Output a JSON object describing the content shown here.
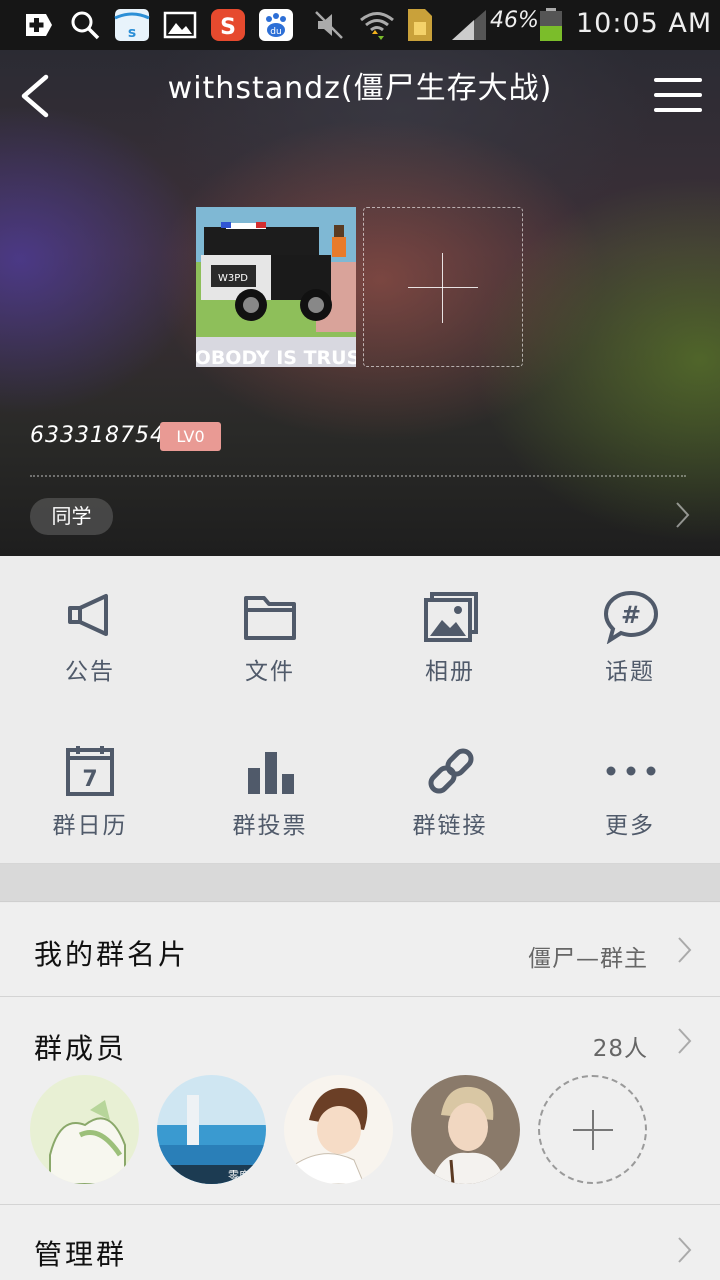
{
  "status_bar": {
    "battery_percent": "46%",
    "time": "10:05 AM",
    "icons": [
      "add-icon",
      "search-icon",
      "store-icon",
      "gallery-icon",
      "sogou-icon",
      "baidu-icon",
      "mute-icon",
      "wifi-icon",
      "sim-icon",
      "signal-icon",
      "battery-icon"
    ]
  },
  "header": {
    "title": "withstandz(僵尸生存大战)",
    "cover_caption": "NOBODY IS TRUST",
    "cover_plate": "W3PD",
    "group_id": "633318754",
    "level": "LV0",
    "tag": "同学"
  },
  "grid": [
    {
      "label": "公告",
      "icon": "announcement-icon"
    },
    {
      "label": "文件",
      "icon": "folder-icon"
    },
    {
      "label": "相册",
      "icon": "album-icon"
    },
    {
      "label": "话题",
      "icon": "topic-icon"
    },
    {
      "label": "群日历",
      "icon": "calendar-icon"
    },
    {
      "label": "群投票",
      "icon": "vote-icon"
    },
    {
      "label": "群链接",
      "icon": "link-icon"
    },
    {
      "label": "更多",
      "icon": "more-icon"
    }
  ],
  "calendar_day": "7",
  "rows": {
    "card": {
      "label": "我的群名片",
      "value": "僵尸—群主"
    },
    "members": {
      "label": "群成员",
      "value": "28人"
    },
    "manage": {
      "label": "管理群"
    }
  },
  "member_avatar_caption": "零度",
  "colors": {
    "level_badge": "#e99a94",
    "icon_gray": "#505a6a",
    "background": "#ececec"
  }
}
